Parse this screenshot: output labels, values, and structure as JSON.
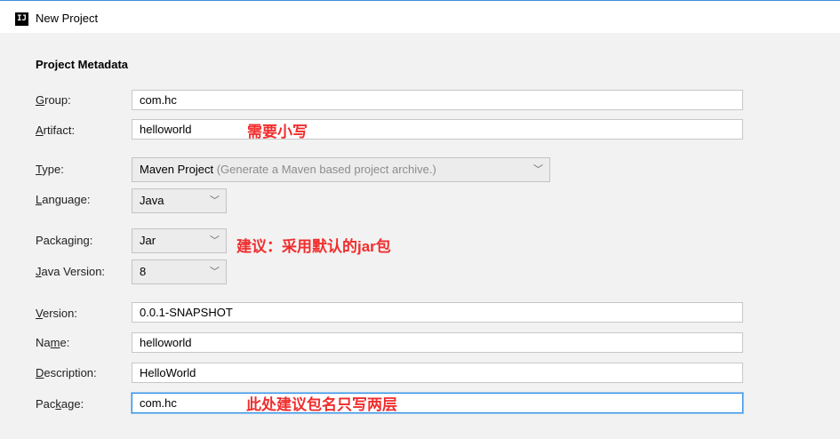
{
  "window": {
    "title": "New Project",
    "icon": "IJ",
    "icon_name": "intellij-icon"
  },
  "section_title": "Project Metadata",
  "fields": {
    "group": {
      "label": "Group:",
      "mnemonic": "G",
      "rest": "roup:",
      "value": "com.hc"
    },
    "artifact": {
      "label": "Artifact:",
      "mnemonic": "A",
      "rest": "rtifact:",
      "value": "helloworld"
    },
    "type": {
      "label": "Type:",
      "mnemonic": "T",
      "rest": "ype:",
      "value": "Maven Project",
      "hint": "(Generate a Maven based project archive.)"
    },
    "language": {
      "label": "Language:",
      "mnemonic": "L",
      "rest": "anguage:",
      "value": "Java"
    },
    "packaging": {
      "label": "Packaging:",
      "pre": "Packa",
      "mnemonic": "g",
      "rest": "ing:",
      "value": "Jar"
    },
    "java_version": {
      "label": "Java Version:",
      "mnemonic": "J",
      "rest": "ava Version:",
      "value": "8"
    },
    "version": {
      "label": "Version:",
      "mnemonic": "V",
      "rest": "ersion:",
      "value": "0.0.1-SNAPSHOT"
    },
    "name": {
      "label": "Name:",
      "pre": "Na",
      "mnemonic": "m",
      "rest": "e:",
      "value": "helloworld"
    },
    "description": {
      "label": "Description:",
      "mnemonic": "D",
      "rest": "escription:",
      "value": "HelloWorld"
    },
    "package": {
      "label": "Package:",
      "pre": "Pac",
      "mnemonic": "k",
      "rest": "age:",
      "value": "com.hc"
    }
  },
  "annotations": {
    "artifact": "需要小写",
    "packaging": "建议：采用默认的jar包",
    "package": "此处建议包名只写两层"
  },
  "colors": {
    "annotation": "#f02d2d",
    "focus": "#2f8fe3",
    "titlebar_line": "#3c8fd8"
  },
  "icons": {
    "dropdown": "chevron-down-icon"
  }
}
